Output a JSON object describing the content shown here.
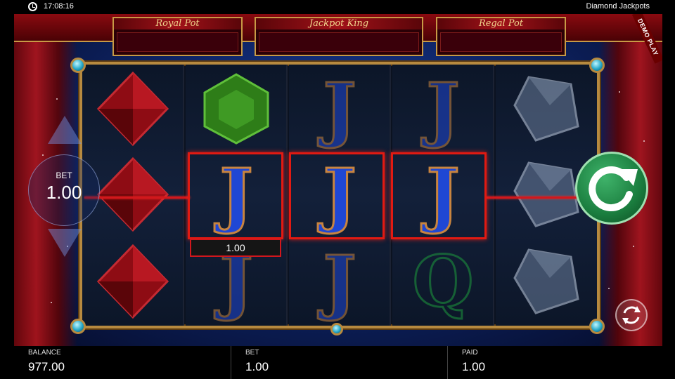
{
  "status_bar": {
    "time": "17:08:16",
    "game_name": "Diamond Jackpots"
  },
  "demo_label": "DEMO PLAY",
  "jackpots": [
    {
      "label": "Royal Pot"
    },
    {
      "label": "Jackpot King"
    },
    {
      "label": "Regal Pot"
    }
  ],
  "bet_control": {
    "label": "BET",
    "value": "1.00"
  },
  "win": {
    "amount": "1.00"
  },
  "reels": [
    [
      "red-gem",
      "red-gem",
      "red-gem"
    ],
    [
      "green-gem",
      "J",
      "J"
    ],
    [
      "J",
      "J",
      "J"
    ],
    [
      "J",
      "J",
      "Q"
    ],
    [
      "clear-gem",
      "clear-gem",
      "clear-gem"
    ]
  ],
  "winning_line": {
    "row": 2,
    "reels": [
      2,
      3,
      4
    ],
    "symbol": "J"
  },
  "icons": {
    "clock": "clock-icon",
    "spin": "spin-arrow-icon",
    "autoplay": "autoplay-icon",
    "bet_up": "triangle-up-icon",
    "bet_down": "triangle-down-icon"
  },
  "colors": {
    "win_highlight": "#e11a12",
    "spin_button": "#1a7d3e",
    "frame_gold": "#b78a3f"
  },
  "bottom_bar": {
    "balance_label": "BALANCE",
    "balance_value": "977.00",
    "bet_label": "BET",
    "bet_value": "1.00",
    "paid_label": "PAID",
    "paid_value": "1.00"
  }
}
